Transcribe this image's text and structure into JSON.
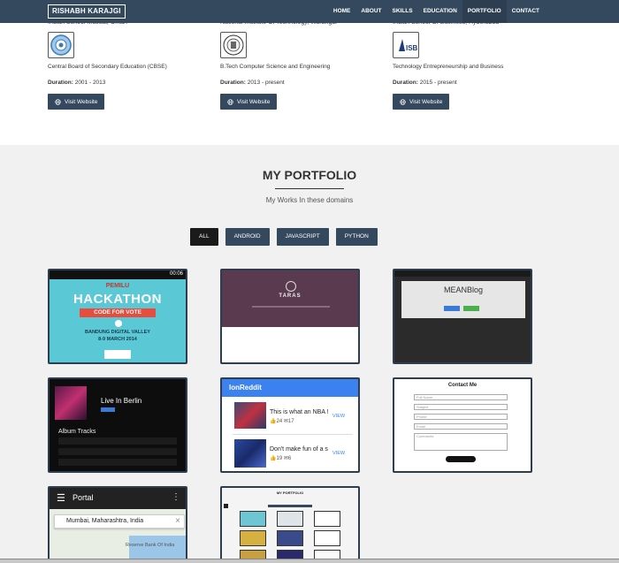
{
  "nav": {
    "brand": "RISHABH KARAJGI",
    "items": [
      "HOME",
      "ABOUT",
      "SKILLS",
      "EDUCATION",
      "PORTFOLIO",
      "CONTACT"
    ],
    "active": "PORTFOLIO"
  },
  "education": [
    {
      "school": "Indian School Muscat, Oman",
      "degree": "Central Board of Secondary Education (CBSE)",
      "duration_label": "Duration:",
      "duration": "2001 - 2013",
      "button": "Visit Website"
    },
    {
      "school": "National Institute Of Technology, Warangal",
      "degree": "B.Tech Computer Science and Engineering",
      "duration_label": "Duration:",
      "duration": "2013 - present",
      "button": "Visit Website"
    },
    {
      "school": "Indian School Of Business, Hyderabad",
      "degree": "Technology Entrepreneurship and Business",
      "duration_label": "Duration:",
      "duration": "2015 - present",
      "button": "Visit Website"
    }
  ],
  "portfolio": {
    "title": "MY PORTFOLIO",
    "subtitle": "My Works In these domains",
    "filters": [
      "ALL",
      "ANDROID",
      "JAVASCRIPT",
      "PYTHON"
    ],
    "active_filter": "ALL",
    "hackathon": {
      "brand": "PEMILU",
      "title": "HACKATHON",
      "tagline": "CODE FOR VOTE",
      "place": "BANDUNG DIGITAL VALLEY",
      "date": "8-9 MARCH 2014",
      "time": "00:06"
    },
    "taras": {
      "name": "TARAS"
    },
    "meanblog": {
      "title": "MEANBlog"
    },
    "music": {
      "title": "Live In Berlin",
      "section": "Album Tracks"
    },
    "ionreddit": {
      "title": "IonReddit",
      "post1": "This is what an NBA !",
      "post1_likes": "24",
      "post1_comments": "17",
      "post2": "Don't make fun of a s",
      "post2_likes": "19",
      "post2_comments": "6",
      "view": "VIEW"
    },
    "contact": {
      "title": "Contact Me",
      "fields": [
        "Full Name",
        "Subject",
        "Phone",
        "Email",
        "Comments"
      ]
    },
    "portal": {
      "title": "Portal",
      "search_value": "Mumbai, Maharashtra, India",
      "map_label": "Reserve Bank Of India"
    },
    "portfolio_thumb": {
      "title": "MY PORTFOLIO"
    }
  }
}
